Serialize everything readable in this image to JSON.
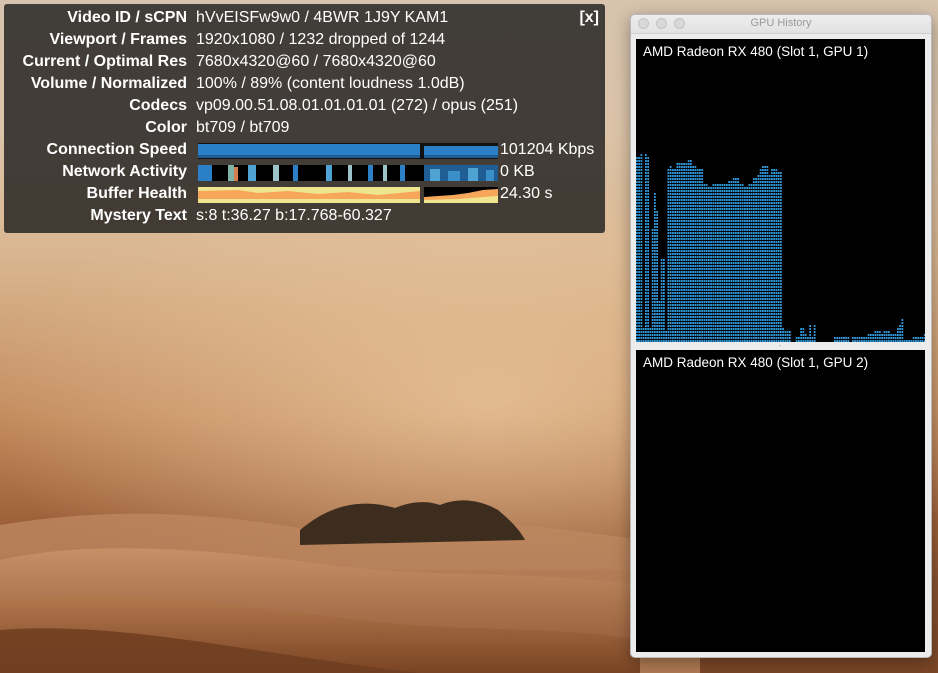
{
  "stats": {
    "close_label": "[x]",
    "rows": [
      {
        "label": "Video ID / sCPN",
        "value": "hVvEISFw9w0 / 4BWR 1J9Y KAM1"
      },
      {
        "label": "Viewport / Frames",
        "value": "1920x1080 / 1232 dropped of 1244"
      },
      {
        "label": "Current / Optimal Res",
        "value": "7680x4320@60 / 7680x4320@60"
      },
      {
        "label": "Volume / Normalized",
        "value": "100% / 89% (content loudness 1.0dB)"
      },
      {
        "label": "Codecs",
        "value": "vp09.00.51.08.01.01.01.01 (272) / opus (251)"
      },
      {
        "label": "Color",
        "value": "bt709 / bt709"
      },
      {
        "label": "Connection Speed",
        "value": "101204 Kbps"
      },
      {
        "label": "Network Activity",
        "value": "0 KB"
      },
      {
        "label": "Buffer Health",
        "value": "24.30 s"
      },
      {
        "label": "Mystery Text",
        "value": "s:8 t:36.27 b:17.768-60.327"
      }
    ]
  },
  "gpu_window": {
    "title": "GPU History",
    "panels": [
      {
        "name": "AMD Radeon RX 480 (Slot 1, GPU 1)",
        "bar_color": "#2f96d8",
        "max": 100,
        "history": [
          62,
          62,
          63,
          5,
          63,
          62,
          5,
          38,
          50,
          44,
          14,
          28,
          28,
          4,
          58,
          59,
          58,
          58,
          60,
          60,
          60,
          60,
          60,
          61,
          61,
          59,
          59,
          58,
          58,
          58,
          53,
          53,
          52,
          52,
          53,
          53,
          53,
          53,
          53,
          53,
          53,
          54,
          54,
          55,
          55,
          55,
          53,
          53,
          52,
          52,
          53,
          53,
          55,
          55,
          56,
          58,
          59,
          59,
          59,
          56,
          58,
          58,
          58,
          57,
          57,
          5,
          4,
          4,
          4,
          0,
          0,
          2,
          2,
          5,
          5,
          3,
          2,
          6,
          2,
          6,
          0,
          0,
          0,
          0,
          0,
          0,
          0,
          0,
          2,
          2,
          2,
          2,
          2,
          2,
          2,
          0,
          2,
          2,
          2,
          2,
          2,
          2,
          2,
          3,
          3,
          3,
          4,
          4,
          4,
          3,
          4,
          4,
          4,
          3,
          3,
          3,
          5,
          6,
          8,
          1,
          1,
          1,
          1,
          2,
          2,
          2,
          2,
          2,
          3
        ]
      },
      {
        "name": "AMD Radeon RX 480 (Slot 1, GPU 2)",
        "bar_color": "#2f96d8",
        "max": 100,
        "history": []
      }
    ]
  }
}
